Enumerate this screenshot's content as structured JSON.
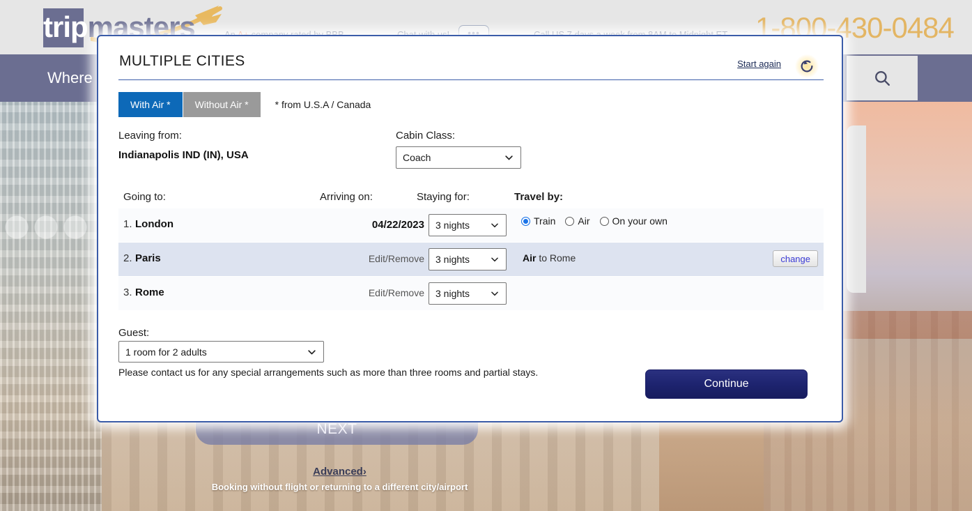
{
  "site_header": {
    "logo_part1": "trip",
    "logo_part2": "masters",
    "bbb_text_prefix": "An ",
    "bbb_badge": "A+",
    "bbb_text_suffix": " company rated by BBB",
    "chat_text": "Chat with us!",
    "chat_icon": "ellipsis-chat-icon",
    "call_text": "Call US 7 days a week from 8AM to Midnight ET",
    "phone": "1-800-430-0484",
    "nav_item": "Where",
    "search_icon": "search-icon"
  },
  "page_background": {
    "next_button": "NEXT",
    "advanced_link": "Advanced",
    "advanced_chevron": "›",
    "advanced_subtitle": "Booking without flight or returning to a different city/airport"
  },
  "modal": {
    "title": "MULTIPLE CITIES",
    "start_again": "Start again",
    "reset_icon": "reset-circular-arrow-icon",
    "tabs": [
      {
        "label": "With Air *",
        "active": true
      },
      {
        "label": "Without Air *",
        "active": false
      }
    ],
    "tab_note": "* from U.S.A / Canada",
    "leaving_from_label": "Leaving from:",
    "leaving_from_value": "Indianapolis IND (IN), USA",
    "cabin_class_label": "Cabin Class:",
    "cabin_class_value": "Coach",
    "columns": {
      "going_to": "Going to:",
      "arriving_on": "Arriving on:",
      "staying_for": "Staying for:",
      "travel_by": "Travel by:"
    },
    "rows": [
      {
        "number": "1.",
        "city": "London",
        "arriving": "04/22/2023",
        "staying": "3 nights",
        "travel_options": [
          {
            "label": "Train",
            "selected": true
          },
          {
            "label": "Air",
            "selected": false
          },
          {
            "label": "On your own",
            "selected": false
          }
        ]
      },
      {
        "number": "2.",
        "city": "Paris",
        "arriving": "Edit/Remove",
        "staying": "3 nights",
        "travel_summary_mode": "Air",
        "travel_summary_rest": " to Rome",
        "change_label": "change"
      },
      {
        "number": "3.",
        "city": "Rome",
        "arriving": "Edit/Remove",
        "staying": "3 nights"
      }
    ],
    "guest_label": "Guest:",
    "guest_value": "1 room for 2 adults",
    "note": "Please contact us for any special arrangements such as more than three rooms and partial stays.",
    "continue_label": "Continue",
    "colors": {
      "accent_blue": "#0d69b8",
      "border_blue": "#3b5ca8",
      "selected_row": "#dde3f0",
      "continue_navy": "#1e2470",
      "nav_purple": "#6b6e91",
      "phone_gold": "#e3b563"
    }
  }
}
